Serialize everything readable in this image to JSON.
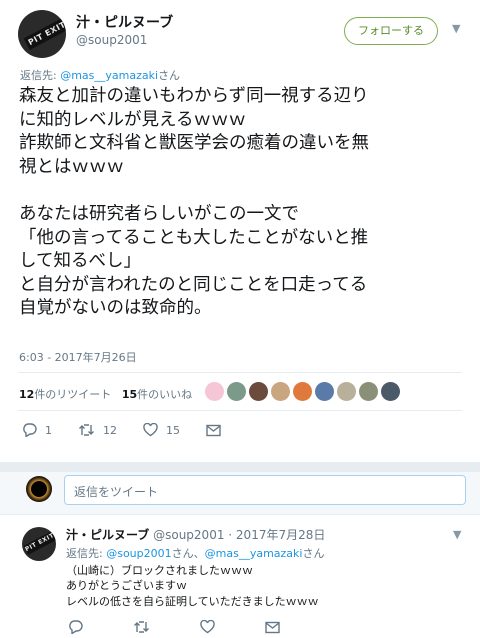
{
  "tweet": {
    "author_name": "汁・ピルヌーブ",
    "author_handle": "@soup2001",
    "avatar_text": "PIT EXIT",
    "follow_label": "フォローする",
    "reply_prefix": "返信先:",
    "reply_mention": "@mas__yamazaki",
    "reply_suffix": "さん",
    "text": "森友と加計の違いもわからず同一視する辺り\nに知的レベルが見えるｗｗｗ\n詐欺師と文科省と獣医学会の癒着の違いを無\n視とはｗｗｗ\n\nあなたは研究者らしいがこの一文で\n「他の言ってることも大したことがないと推\nして知るべし」\nと自分が言われたのと同じことを口走ってる\n自覚がないのは致命的。",
    "timestamp": "6:03 - 2017年7月26日",
    "retweets_count": "12",
    "retweets_label": "件のリツイート",
    "likes_count": "15",
    "likes_label": "件のいいね",
    "liker_colors": [
      "#f4c6d6",
      "#7b9a8a",
      "#6b4b3b",
      "#c9a680",
      "#e07a3c",
      "#5a7aa8",
      "#b9b09b",
      "#8a9078",
      "#4b5a68"
    ],
    "actions": {
      "reply_count": "1",
      "retweet_count": "12",
      "like_count": "15"
    }
  },
  "compose": {
    "placeholder": "返信をツイート"
  },
  "reply": {
    "author_name": "汁・ピルヌーブ",
    "author_handle": "@soup2001",
    "date": "· 2017年7月28日",
    "reply_prefix": "返信先:",
    "mention_1": "@soup2001",
    "between": "さん、",
    "mention_2": "@mas__yamazaki",
    "suffix": "さん",
    "text": "（山崎に）ブロックされましたｗｗｗ\nありがとうございますｗ\nレベルの低さを自ら証明していただきましたｗｗｗ"
  },
  "colors": {
    "follow_green": "#5b8a2f",
    "link_blue": "#1b95e0",
    "muted": "#657786"
  }
}
